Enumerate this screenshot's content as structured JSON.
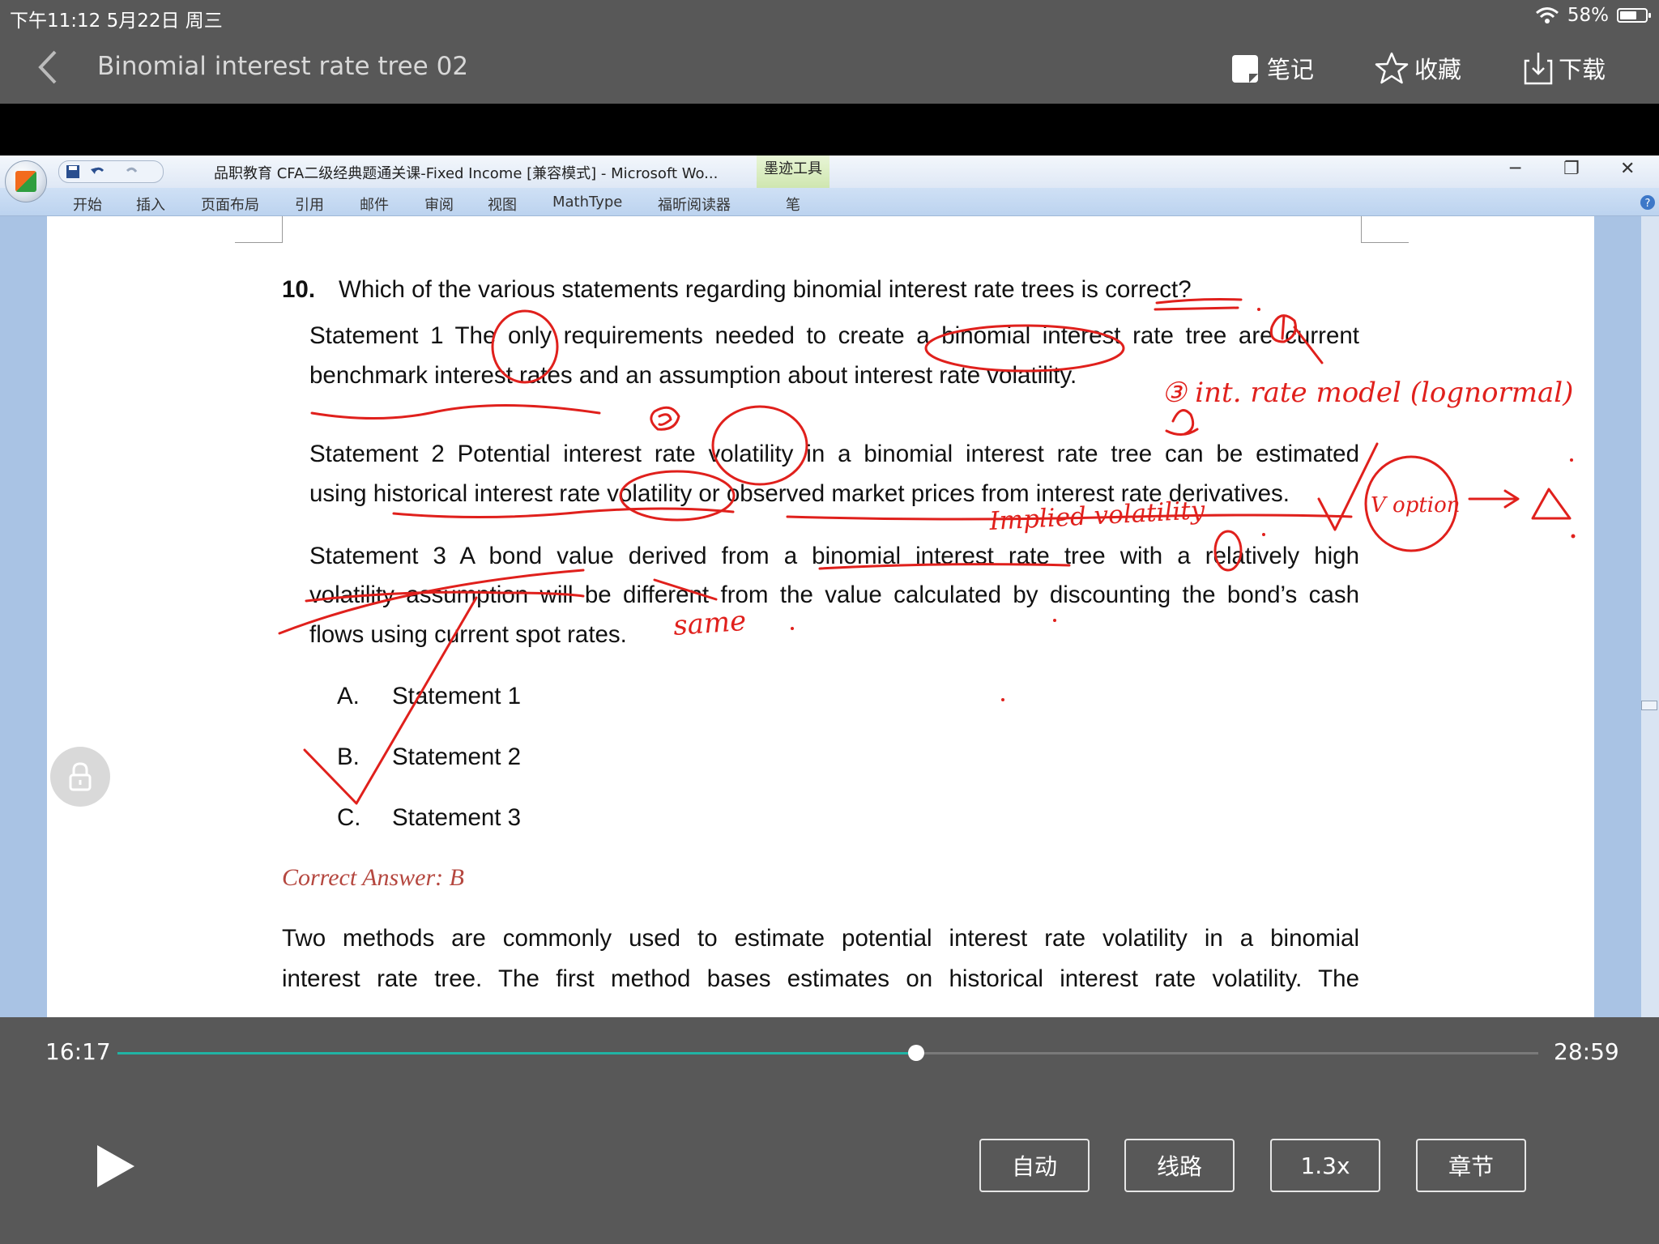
{
  "status_bar": {
    "time_date": "下午11:12   5月22日 周三",
    "battery": "58%",
    "battery_level": 0.58
  },
  "nav": {
    "title": "Binomial interest rate tree 02",
    "notes_label": "笔记",
    "favorite_label": "收藏",
    "download_label": "下载"
  },
  "word": {
    "title": "品职教育 CFA二级经典题通关课-Fixed Income [兼容模式] - Microsoft Wo...",
    "context_tab": "墨迹工具",
    "tabs": [
      "开始",
      "插入",
      "页面布局",
      "引用",
      "邮件",
      "审阅",
      "视图",
      "MathType",
      "福昕阅读器",
      "笔"
    ]
  },
  "question": {
    "number": "10.",
    "text": "Which of the various statements regarding binomial interest rate trees is correct?",
    "statements": [
      [
        "Statement 1 The only requirements needed to create a binomial interest rate tree are current",
        "benchmark interest rates and an assumption about interest rate volatility."
      ],
      [
        "Statement 2 Potential interest rate volatility in a binomial interest rate tree can be estimated",
        "using historical interest rate volatility or observed market prices from interest rate derivatives."
      ],
      [
        "Statement 3 A bond value derived from a binomial interest rate tree with a relatively high",
        "volatility assumption will be different from the value calculated by discounting the bond’s cash",
        "flows using current spot rates."
      ]
    ],
    "options": [
      {
        "letter": "A.",
        "text": "Statement 1"
      },
      {
        "letter": "B.",
        "text": "Statement 2"
      },
      {
        "letter": "C.",
        "text": "Statement 3"
      }
    ],
    "answer": "Correct Answer: B",
    "explanation": [
      "Two methods are commonly used to estimate potential interest rate volatility in a binomial",
      "interest rate tree. The first method bases estimates on historical interest rate volatility. The"
    ]
  },
  "handwriting": {
    "note_1": "③ int. rate model (lognormal)",
    "note_2": "Implied volatility",
    "note_3": "V option",
    "note_4": "same"
  },
  "player": {
    "current_time": "16:17",
    "total_time": "28:59",
    "progress": 0.562,
    "buttons": [
      "自动",
      "线路",
      "1.3x",
      "章节"
    ]
  },
  "colors": {
    "accent": "#21b3a4",
    "ink": "#e0201c",
    "answer": "#b5473f"
  }
}
